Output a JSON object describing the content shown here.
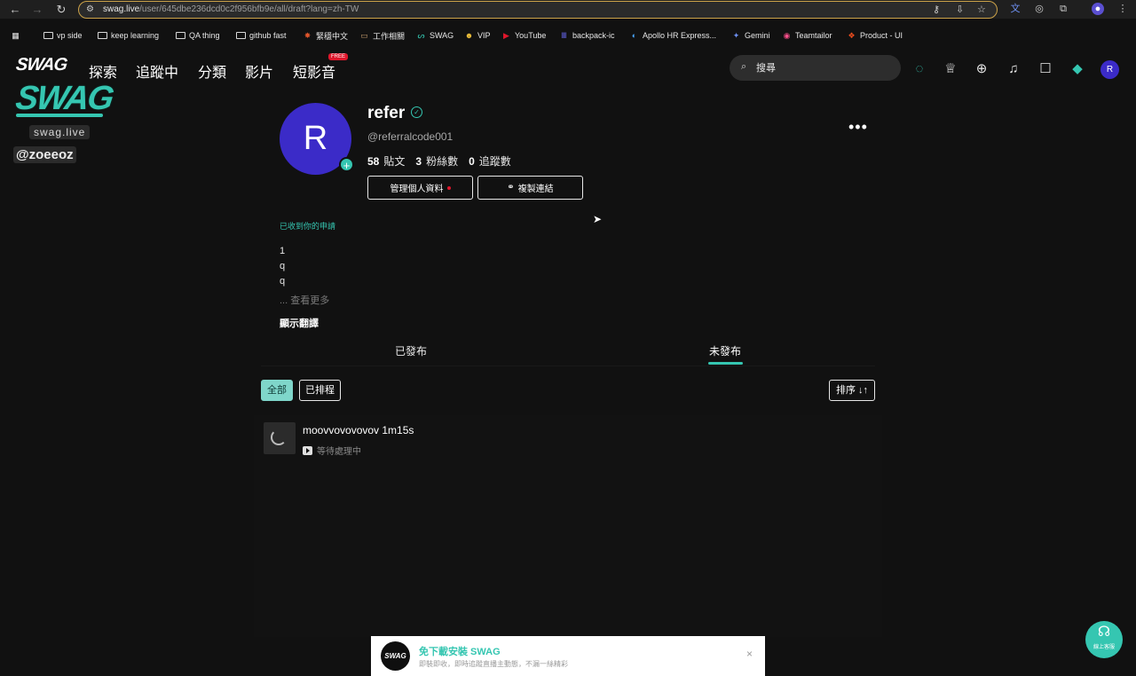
{
  "browser": {
    "url_host": "swag.live",
    "url_path": "/user/645dbe236dcd0c2f956bfb9e/all/draft?lang=zh-TW",
    "bookmarks": [
      {
        "label": "vp side",
        "icon": "folder-icon"
      },
      {
        "label": "keep learning",
        "icon": "folder-icon"
      },
      {
        "label": "QA thing",
        "icon": "folder-icon"
      },
      {
        "label": "github fast",
        "icon": "folder-icon"
      },
      {
        "label": "緊穩中文",
        "icon": "star-burst-icon"
      },
      {
        "label": "工作相關",
        "icon": "briefcase-icon"
      },
      {
        "label": "SWAG",
        "icon": "swag-icon"
      },
      {
        "label": "VIP",
        "icon": "emoji-icon"
      },
      {
        "label": "YouTube",
        "icon": "youtube-icon"
      },
      {
        "label": "backpack-ic",
        "icon": "backpack-icon"
      },
      {
        "label": "Apollo HR Express...",
        "icon": "apollo-icon"
      },
      {
        "label": "Gemini",
        "icon": "gemini-icon"
      },
      {
        "label": "Teamtailor",
        "icon": "teamtailor-icon"
      },
      {
        "label": "Product - UI",
        "icon": "figma-icon"
      }
    ]
  },
  "header": {
    "logo": "SWAG",
    "nav": [
      "探索",
      "追蹤中",
      "分類",
      "影片",
      "短影音"
    ],
    "free_badge": "FREE",
    "search_placeholder": "搜尋",
    "avatar_letter": "R"
  },
  "watermark": {
    "logo": "SWAG",
    "site": "swag.live",
    "handle": "@zoeeoz"
  },
  "profile": {
    "avatar_letter": "R",
    "name": "refer",
    "handle": "@referralcode001",
    "posts_count": "58",
    "posts_label": "貼文",
    "followers_count": "3",
    "followers_label": "粉絲數",
    "following_count": "0",
    "following_label": "追蹤數",
    "manage_button": "管理個人資料",
    "copy_link_button": "複製連結",
    "received_note": "已收到你的申請",
    "bio_lines": [
      "1",
      "q",
      "q"
    ],
    "see_more": "... 查看更多",
    "show_translation": "顯示翻譯"
  },
  "tabs": {
    "published": "已發布",
    "unpublished": "未發布",
    "active": "unpublished"
  },
  "filters": {
    "all": "全部",
    "scheduled": "已排程",
    "sort": "排序 ↓↑"
  },
  "posts": [
    {
      "title": "moovvovovovov 1m15s",
      "status": "等待處理中"
    }
  ],
  "banner": {
    "logo": "SWAG",
    "title": "免下載安裝 SWAG",
    "subtitle": "即裝即收，即時追蹤直播主動態，不漏一絲精彩",
    "close": "×"
  },
  "support": {
    "label": "線上客服"
  },
  "colors": {
    "accent": "#35c6b1",
    "avatar": "#3b2bc8",
    "badge_red": "#e0162b"
  }
}
